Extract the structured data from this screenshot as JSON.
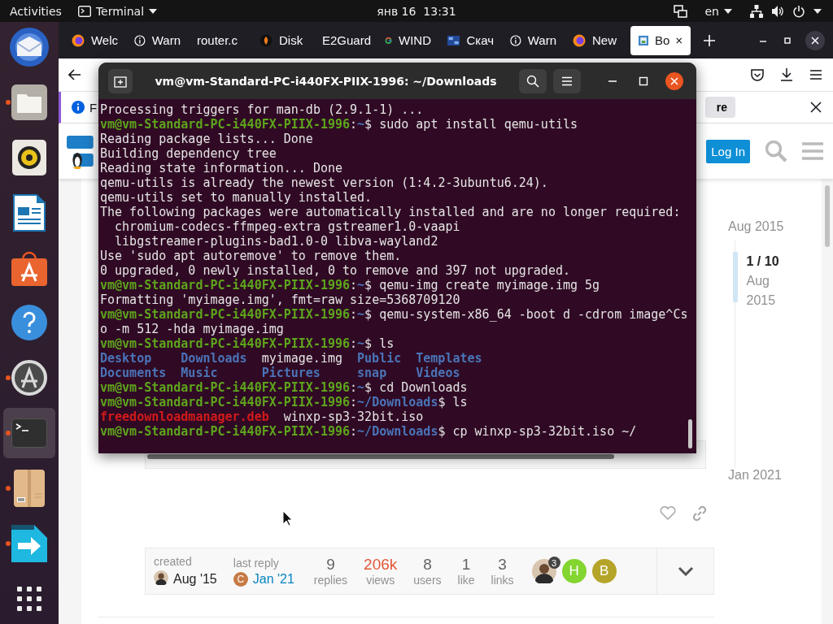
{
  "top_bar": {
    "activities": "Activities",
    "app_menu": "Terminal",
    "clock": "янв 16  13:31",
    "language": "en"
  },
  "dock": {
    "items": [
      {
        "kind": "mail",
        "running": false,
        "selected": false
      },
      {
        "kind": "files",
        "running": true,
        "selected": false
      },
      {
        "kind": "music",
        "running": false,
        "selected": false
      },
      {
        "kind": "writer",
        "running": false,
        "selected": false
      },
      {
        "kind": "store",
        "running": false,
        "selected": false
      },
      {
        "kind": "help",
        "running": false,
        "selected": false
      },
      {
        "kind": "updater",
        "running": true,
        "selected": false
      },
      {
        "kind": "terminal",
        "running": true,
        "selected": true
      },
      {
        "kind": "archive",
        "running": true,
        "selected": false
      },
      {
        "kind": "transfer",
        "running": true,
        "selected": false
      },
      {
        "kind": "apps",
        "running": false,
        "selected": false
      }
    ]
  },
  "browser": {
    "tabs": [
      {
        "label": "Welc",
        "kind": "firefox",
        "selected": false
      },
      {
        "label": "Warn",
        "kind": "info",
        "selected": false
      },
      {
        "label": "router.c",
        "selected": false
      },
      {
        "label": "Disk",
        "kind": "disk",
        "selected": false
      },
      {
        "label": "E2Guard",
        "selected": false
      },
      {
        "label": "WIND",
        "kind": "google",
        "selected": false
      },
      {
        "label": "Скач",
        "kind": "image",
        "selected": false
      },
      {
        "label": "Warn",
        "kind": "info",
        "selected": false
      },
      {
        "label": "New",
        "kind": "firefox",
        "selected": false
      },
      {
        "label": "Bo",
        "kind": "site",
        "selected": true
      }
    ],
    "notification": {
      "text": "F",
      "action": "re"
    },
    "site_header": {
      "login": "Log In"
    },
    "timeline": {
      "start": "Aug 2015",
      "position": "1 / 10",
      "month": "Aug",
      "year": "2015",
      "end": "Jan 2021"
    },
    "topic_map": {
      "created_label": "created",
      "created_date": "Aug '15",
      "last_reply_label": "last reply",
      "last_reply_date": "Jan '21",
      "last_reply_avatar": {
        "letter": "C",
        "color": "#c77a44"
      },
      "stats": [
        {
          "value": "9",
          "label": "replies",
          "highlighted": false
        },
        {
          "value": "206k",
          "label": "views",
          "highlighted": true
        },
        {
          "value": "8",
          "label": "users",
          "highlighted": false
        },
        {
          "value": "1",
          "label": "like",
          "highlighted": false
        },
        {
          "value": "3",
          "label": "links",
          "highlighted": false
        }
      ],
      "participants": [
        {
          "kind": "photo",
          "count": "3"
        },
        {
          "kind": "letter",
          "letter": "H",
          "color": "#83d52f"
        },
        {
          "kind": "letter",
          "letter": "B",
          "color": "#b5a42a"
        }
      ]
    }
  },
  "terminal": {
    "title": "vm@vm-Standard-PC-i440FX-PIIX-1996: ~/Downloads",
    "lines": [
      {
        "kind": "text",
        "segments": [
          {
            "text": "Processing triggers for man-db (2.9.1-1) ...",
            "kind": "plain"
          }
        ]
      },
      {
        "kind": "text",
        "segments": [
          {
            "text": "vm@vm-Standard-PC-i440FX-PIIX-1996",
            "kind": "user"
          },
          {
            "text": ":",
            "kind": "plain"
          },
          {
            "text": "~",
            "kind": "path"
          },
          {
            "text": "$ sudo apt install qemu-utils",
            "kind": "plain"
          }
        ]
      },
      {
        "kind": "text",
        "segments": [
          {
            "text": "Reading package lists... Done",
            "kind": "plain"
          }
        ]
      },
      {
        "kind": "text",
        "segments": [
          {
            "text": "Building dependency tree",
            "kind": "plain"
          }
        ]
      },
      {
        "kind": "text",
        "segments": [
          {
            "text": "Reading state information... Done",
            "kind": "plain"
          }
        ]
      },
      {
        "kind": "text",
        "segments": [
          {
            "text": "qemu-utils is already the newest version (1:4.2-3ubuntu6.24).",
            "kind": "plain"
          }
        ]
      },
      {
        "kind": "text",
        "segments": [
          {
            "text": "qemu-utils set to manually installed.",
            "kind": "plain"
          }
        ]
      },
      {
        "kind": "text",
        "segments": [
          {
            "text": "The following packages were automatically installed and are no longer required:",
            "kind": "plain"
          }
        ]
      },
      {
        "kind": "text",
        "segments": [
          {
            "text": "  chromium-codecs-ffmpeg-extra gstreamer1.0-vaapi",
            "kind": "plain"
          }
        ]
      },
      {
        "kind": "text",
        "segments": [
          {
            "text": "  libgstreamer-plugins-bad1.0-0 libva-wayland2",
            "kind": "plain"
          }
        ]
      },
      {
        "kind": "text",
        "segments": [
          {
            "text": "Use 'sudo apt autoremove' to remove them.",
            "kind": "plain"
          }
        ]
      },
      {
        "kind": "text",
        "segments": [
          {
            "text": "0 upgraded, 0 newly installed, 0 to remove and 397 not upgraded.",
            "kind": "plain"
          }
        ]
      },
      {
        "kind": "text",
        "segments": [
          {
            "text": "vm@vm-Standard-PC-i440FX-PIIX-1996",
            "kind": "user"
          },
          {
            "text": ":",
            "kind": "plain"
          },
          {
            "text": "~",
            "kind": "path"
          },
          {
            "text": "$ qemu-img create myimage.img 5g",
            "kind": "plain"
          }
        ]
      },
      {
        "kind": "text",
        "segments": [
          {
            "text": "Formatting 'myimage.img', fmt=raw size=5368709120",
            "kind": "plain"
          }
        ]
      },
      {
        "kind": "text",
        "segments": [
          {
            "text": "vm@vm-Standard-PC-i440FX-PIIX-1996",
            "kind": "user"
          },
          {
            "text": ":",
            "kind": "plain"
          },
          {
            "text": "~",
            "kind": "path"
          },
          {
            "text": "$ qemu-system-x86_64 -boot d -cdrom image^Cso -m 512 -hda myimage.img",
            "kind": "plain"
          }
        ]
      },
      {
        "kind": "text",
        "segments": [
          {
            "text": "vm@vm-Standard-PC-i440FX-PIIX-1996",
            "kind": "user"
          },
          {
            "text": ":",
            "kind": "plain"
          },
          {
            "text": "~",
            "kind": "path"
          },
          {
            "text": "$ ls",
            "kind": "plain"
          }
        ]
      },
      {
        "kind": "ls",
        "rows": [
          [
            {
              "text": "Desktop",
              "kind": "dir"
            },
            {
              "text": "Downloads",
              "kind": "dir"
            },
            {
              "text": "myimage.img",
              "kind": "file"
            },
            {
              "text": "Public",
              "kind": "dir"
            },
            {
              "text": "Templates",
              "kind": "dir"
            }
          ],
          [
            {
              "text": "Documents",
              "kind": "dir"
            },
            {
              "text": "Music",
              "kind": "dir"
            },
            {
              "text": "Pictures",
              "kind": "dir"
            },
            {
              "text": "snap",
              "kind": "dir"
            },
            {
              "text": "Videos",
              "kind": "dir"
            }
          ]
        ]
      },
      {
        "kind": "text",
        "segments": [
          {
            "text": "vm@vm-Standard-PC-i440FX-PIIX-1996",
            "kind": "user"
          },
          {
            "text": ":",
            "kind": "plain"
          },
          {
            "text": "~",
            "kind": "path"
          },
          {
            "text": "$ cd Downloads",
            "kind": "plain"
          }
        ]
      },
      {
        "kind": "text",
        "segments": [
          {
            "text": "vm@vm-Standard-PC-i440FX-PIIX-1996",
            "kind": "user"
          },
          {
            "text": ":",
            "kind": "plain"
          },
          {
            "text": "~/Downloads",
            "kind": "path"
          },
          {
            "text": "$ ls",
            "kind": "plain"
          }
        ]
      },
      {
        "kind": "ls",
        "rows": [
          [
            {
              "text": "freedownloadmanager.deb",
              "kind": "archive"
            },
            {
              "text": "winxp-sp3-32bit.iso",
              "kind": "file"
            }
          ]
        ]
      },
      {
        "kind": "text",
        "segments": [
          {
            "text": "vm@vm-Standard-PC-i440FX-PIIX-1996",
            "kind": "user"
          },
          {
            "text": ":",
            "kind": "plain"
          },
          {
            "text": "~/Downloads",
            "kind": "path"
          },
          {
            "text": "$ cp winxp-sp3-32bit.iso ~/",
            "kind": "plain"
          }
        ]
      }
    ]
  }
}
